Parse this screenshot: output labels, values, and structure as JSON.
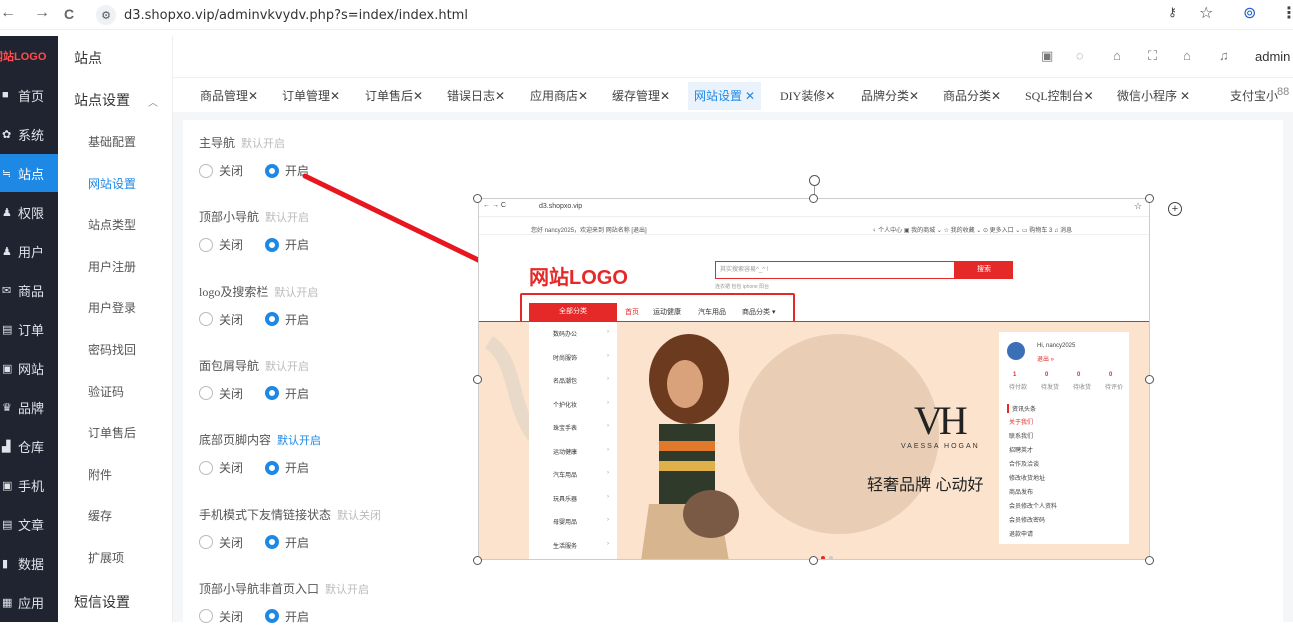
{
  "browser": {
    "back": "←",
    "forward": "→",
    "reload": "C",
    "url": "d3.shopxo.vip/adminvkvydv.php?s=index/index.html",
    "key_icon": "key-icon",
    "star_icon": "☆",
    "profile_icon": "⊚",
    "menu_icon": "⋮"
  },
  "sidebar": {
    "logo": "网站LOGO",
    "items": [
      {
        "icon": "■",
        "label": "首页"
      },
      {
        "icon": "✿",
        "label": "系统"
      },
      {
        "icon": "≒",
        "label": "站点"
      },
      {
        "icon": "♟",
        "label": "权限"
      },
      {
        "icon": "♟",
        "label": "用户"
      },
      {
        "icon": "✉",
        "label": "商品"
      },
      {
        "icon": "▤",
        "label": "订单"
      },
      {
        "icon": "▣",
        "label": "网站"
      },
      {
        "icon": "♛",
        "label": "品牌"
      },
      {
        "icon": "▟",
        "label": "仓库"
      },
      {
        "icon": "▣",
        "label": "手机"
      },
      {
        "icon": "▤",
        "label": "文章"
      },
      {
        "icon": "▮",
        "label": "数据"
      },
      {
        "icon": "▦",
        "label": "应用"
      }
    ]
  },
  "subsidebar": {
    "title": "站点",
    "group": "站点设置",
    "items": [
      "基础配置",
      "网站设置",
      "站点类型",
      "用户注册",
      "用户登录",
      "密码找回",
      "验证码",
      "订单售后",
      "附件",
      "缓存",
      "扩展项"
    ],
    "group2": "短信设置"
  },
  "header": {
    "admin": "admin",
    "icons": [
      "▣",
      "◌",
      "⌂",
      "⛶",
      "⌂",
      "♫"
    ]
  },
  "tabs": [
    "商品管理✕",
    "订单管理✕",
    "订单售后✕",
    "错误日志✕",
    "应用商店✕",
    "缓存管理✕",
    "网站设置 ✕",
    "DIY装修✕",
    "品牌分类✕",
    "商品分类✕",
    "SQL控制台✕",
    "微信小程序 ✕",
    "支付宝小"
  ],
  "tabs_more": "88",
  "settings": [
    {
      "label": "主导航",
      "hint": "默认开启",
      "off": "关闭",
      "on": "开启"
    },
    {
      "label": "顶部小导航",
      "hint": "默认开启",
      "off": "关闭",
      "on": "开启"
    },
    {
      "label": "logo及搜索栏",
      "hint": "默认开启",
      "off": "关闭",
      "on": "开启"
    },
    {
      "label": "面包屑导航",
      "hint": "默认开启",
      "off": "关闭",
      "on": "开启"
    },
    {
      "label": "底部页脚内容",
      "hint": "默认开启",
      "off": "关闭",
      "on": "开启"
    },
    {
      "label": "手机模式下友情链接状态",
      "hint": "默认关闭",
      "off": "关闭",
      "on": "开启"
    },
    {
      "label": "顶部小导航非首页入口",
      "hint": "默认开启",
      "off": "关闭",
      "on": "开启"
    }
  ],
  "shot": {
    "url": "d3.shopxo.vip",
    "welcome": "您好 nancy2025，欢迎来到 网站名称 [退出]",
    "top_links": "♀ 个人中心   ▣ 我的商城 ⌄   ☆ 我的收藏 ⌄   ⊙ 更多入口 ⌄   ▭ 购物车 3   ♫ 消息",
    "logo": "网站LOGO",
    "search_placeholder": "其实搜索容易^_^ !",
    "search_btn": "搜索",
    "hot": "连衣裙   包包   iphone   阳台",
    "allcat": "全部分类",
    "nav": [
      "首页",
      "运动健康",
      "汽车用品",
      "商品分类 ▾"
    ],
    "cats": [
      "数码办公",
      "时尚服饰",
      "名品潮包",
      "个护化妆",
      "珠宝手表",
      "运动健康",
      "汽车用品",
      "玩具乐器",
      "母婴用品",
      "生活服务"
    ],
    "brand": "VH",
    "brand_sub": "VAESSA HOGAN",
    "slogan": "轻奢品牌 心动好",
    "user_greet": "Hi, nancy2025",
    "user_logout": "退出 »",
    "stats": [
      "1",
      "0",
      "0",
      "0"
    ],
    "stat_labels": [
      "待付款",
      "待发货",
      "待收货",
      "待评价"
    ],
    "news_title": "资讯头条",
    "news": [
      "关于我们",
      "联系我们",
      "招聘英才",
      "合作及洽谈",
      "修改收货地址",
      "商品发布",
      "会员修改个人资料",
      "会员修改密码",
      "退款申请"
    ]
  },
  "colors": {
    "accent": "#1e88e5",
    "sidebar": "#1f2430",
    "brand_red": "#e52828"
  }
}
